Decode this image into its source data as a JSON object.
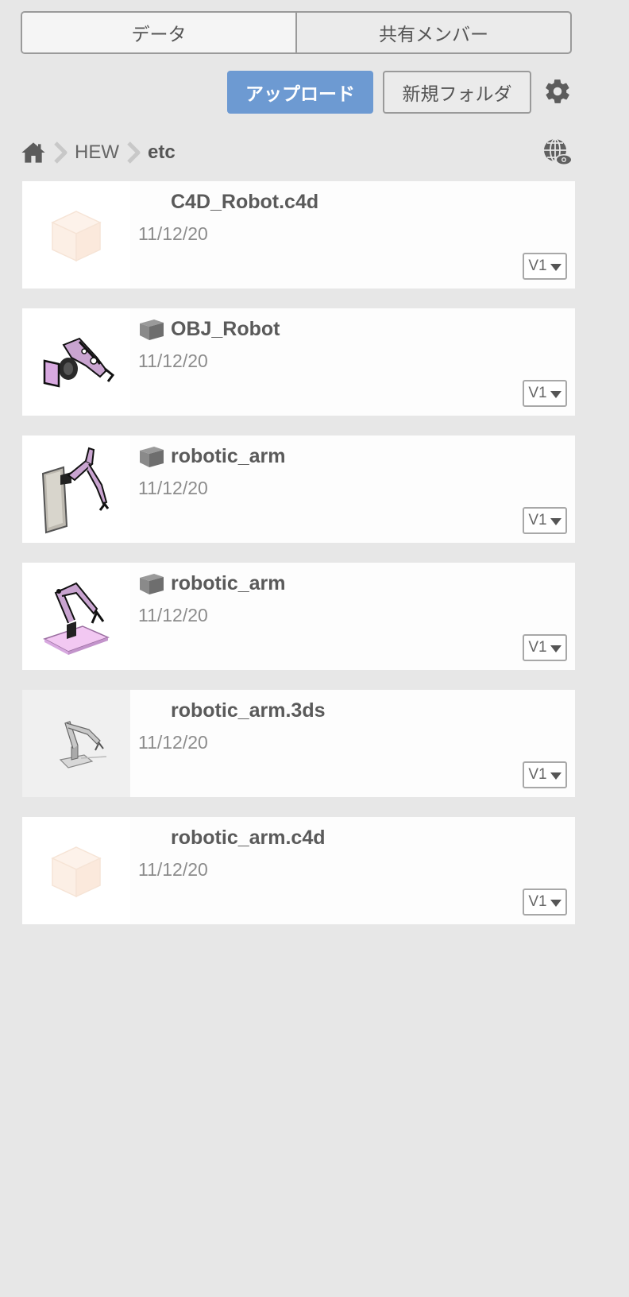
{
  "tabs": [
    {
      "label": "データ",
      "active": true
    },
    {
      "label": "共有メンバー",
      "active": false
    }
  ],
  "toolbar": {
    "upload_label": "アップロード",
    "new_folder_label": "新規フォルダ",
    "settings_icon": "gear-icon"
  },
  "breadcrumb": {
    "home_icon": "home-icon",
    "items": [
      "HEW",
      "etc"
    ],
    "view_icon": "globe-eye-icon"
  },
  "files": [
    {
      "name": "C4D_Robot.c4d",
      "date": "11/12/20",
      "version": "V1",
      "thumb": "placeholder-cube",
      "model_icon": false
    },
    {
      "name": "OBJ_Robot",
      "date": "11/12/20",
      "version": "V1",
      "thumb": "robot-gripper",
      "model_icon": true
    },
    {
      "name": "robotic_arm",
      "date": "11/12/20",
      "version": "V1",
      "thumb": "arm-wall-panel",
      "model_icon": true
    },
    {
      "name": "robotic_arm",
      "date": "11/12/20",
      "version": "V1",
      "thumb": "arm-on-base",
      "model_icon": true
    },
    {
      "name": "robotic_arm.3ds",
      "date": "11/12/20",
      "version": "V1",
      "thumb": "arm-grey",
      "model_icon": false
    },
    {
      "name": "robotic_arm.c4d",
      "date": "11/12/20",
      "version": "V1",
      "thumb": "placeholder-cube",
      "model_icon": false
    }
  ],
  "colors": {
    "background": "#e7e7e7",
    "primary_button": "#6d9ad2",
    "card": "#fdfdfd"
  }
}
